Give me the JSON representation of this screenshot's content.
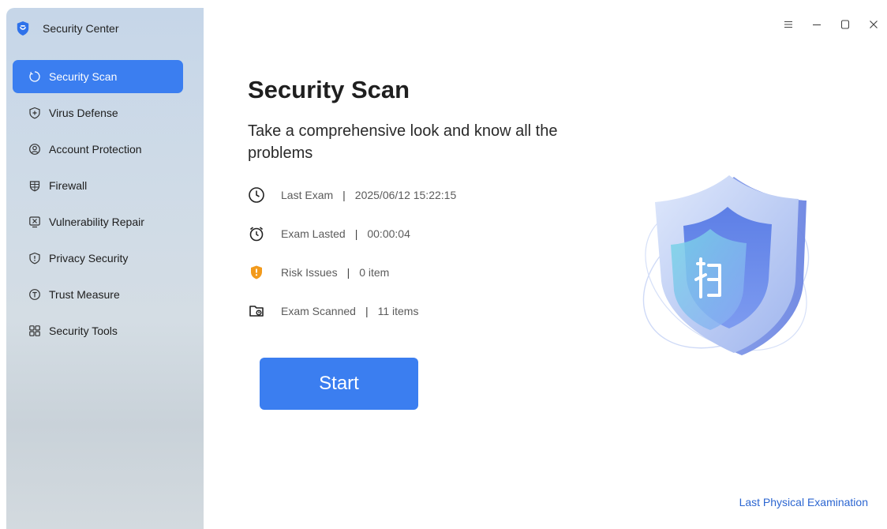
{
  "app": {
    "title": "Security Center"
  },
  "sidebar": {
    "items": [
      {
        "label": "Security Scan",
        "icon": "scan-icon",
        "active": true
      },
      {
        "label": "Virus Defense",
        "icon": "shield-plus-icon"
      },
      {
        "label": "Account Protection",
        "icon": "account-icon"
      },
      {
        "label": "Firewall",
        "icon": "firewall-icon"
      },
      {
        "label": "Vulnerability Repair",
        "icon": "vulnerability-icon"
      },
      {
        "label": "Privacy Security",
        "icon": "privacy-icon"
      },
      {
        "label": "Trust Measure",
        "icon": "trust-icon"
      },
      {
        "label": "Security Tools",
        "icon": "tools-icon"
      }
    ]
  },
  "window": {
    "controls": [
      "menu-icon",
      "minimize-icon",
      "maximize-icon",
      "close-icon"
    ]
  },
  "main": {
    "title": "Security Scan",
    "subtitle": "Take a comprehensive look and know all the problems",
    "info": [
      {
        "label": "Last Exam",
        "value": "2025/06/12 15:22:15",
        "icon": "clock-icon"
      },
      {
        "label": "Exam Lasted",
        "value": "00:00:04",
        "icon": "alarm-icon"
      },
      {
        "label": "Risk Issues",
        "value": "0 item",
        "icon": "risk-shield-icon"
      },
      {
        "label": "Exam Scanned",
        "value": "11 items",
        "icon": "folder-scan-icon"
      }
    ],
    "start_label": "Start",
    "footer_link": "Last Physical Examination"
  },
  "colors": {
    "accent": "#3b7ef0",
    "warning": "#f29a1c",
    "link": "#2c66d1"
  }
}
